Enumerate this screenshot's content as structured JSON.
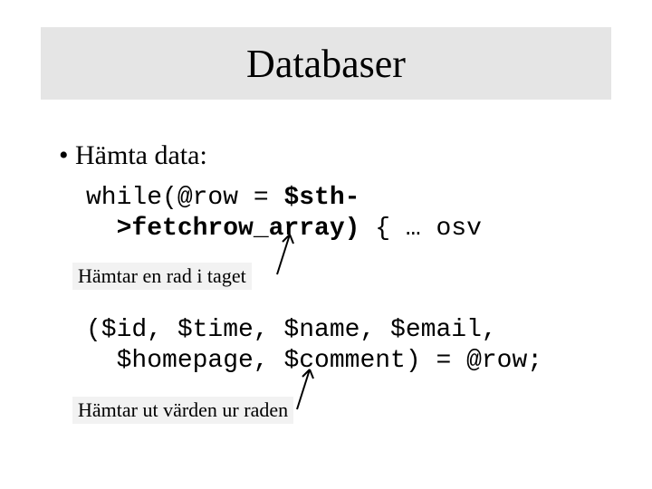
{
  "title": "Databaser",
  "bullet": "Hämta data:",
  "code1": {
    "pre_bold": "while(@row = ",
    "bold": "$sth-\n  >fetchrow_array)",
    "post_bold": " { … osv"
  },
  "note1": "Hämtar en rad i taget",
  "code2": "($id, $time, $name, $email,\n  $homepage, $comment) = @row;",
  "note2": "Hämtar ut värden ur raden"
}
